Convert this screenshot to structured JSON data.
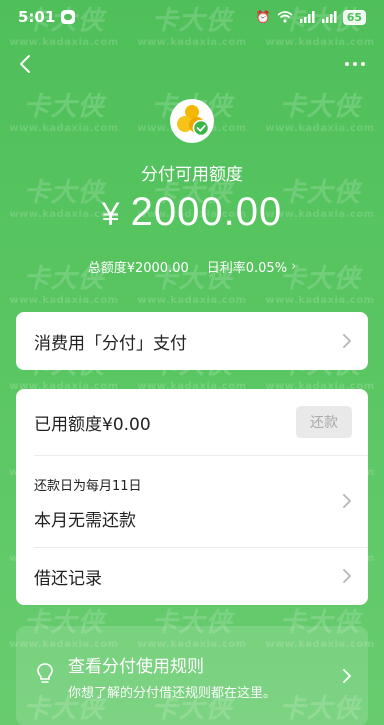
{
  "status_bar": {
    "time": "5:01",
    "battery": "65"
  },
  "watermark": {
    "text": "卡大侠",
    "url": "www.kadaxia.com"
  },
  "hero": {
    "label": "分付可用额度",
    "currency": "¥",
    "amount": "2000.00",
    "total_limit": "总额度¥2000.00",
    "daily_rate": "日利率0.05%"
  },
  "pay_card": {
    "label": "消费用「分付」支付"
  },
  "usage_card": {
    "used_amount": "已用额度¥0.00",
    "repay_button": "还款",
    "due_label": "还款日为每月11日",
    "due_status": "本月无需还款",
    "history_label": "借还记录"
  },
  "rules_card": {
    "title": "查看分付使用规则",
    "description": "你想了解的分付借还规则都在这里。"
  },
  "colors": {
    "brand_green": "#4fbf5a",
    "card_bg": "#ffffff",
    "disabled_button": "#e9e9e9"
  }
}
